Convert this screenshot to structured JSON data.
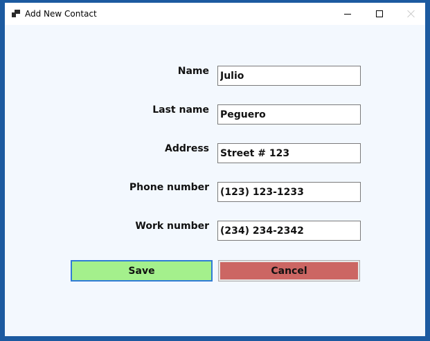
{
  "window": {
    "title": "Add New Contact",
    "icons": {
      "app": "app-window-icon",
      "minimize": "minimize-icon",
      "maximize": "maximize-icon",
      "close": "close-icon"
    }
  },
  "form": {
    "fields": [
      {
        "label": "Name",
        "value": "Julio"
      },
      {
        "label": "Last name",
        "value": "Peguero"
      },
      {
        "label": "Address",
        "value": "Street # 123"
      },
      {
        "label": "Phone number",
        "value": "(123) 123-1233"
      },
      {
        "label": "Work number",
        "value": "(234) 234-2342"
      }
    ],
    "save_label": "Save",
    "cancel_label": "Cancel"
  },
  "colors": {
    "frame": "#1c5aa0",
    "client_background": "#f3f8fe",
    "save_button": "#a4f08c",
    "save_border": "#2f7bd6",
    "cancel_button": "#cc6663"
  }
}
